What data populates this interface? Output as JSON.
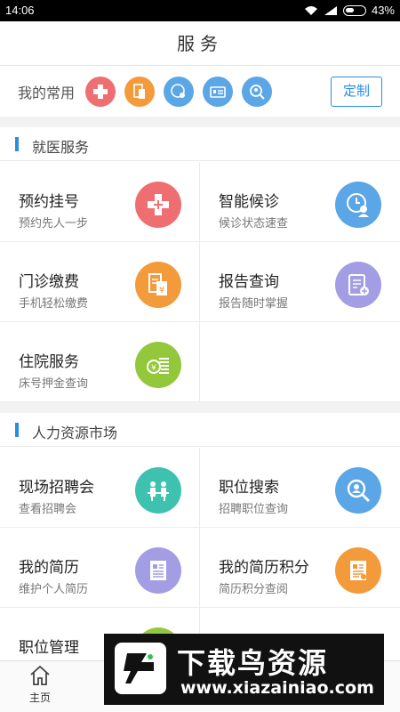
{
  "status": {
    "time": "14:06",
    "battery": "43%"
  },
  "header": {
    "title": "服务"
  },
  "frequent": {
    "label": "我的常用",
    "custom_label": "定制",
    "icons": [
      {
        "icon": "cross-icon",
        "color": "#ef6e72"
      },
      {
        "icon": "receipt-icon",
        "color": "#f39a3b"
      },
      {
        "icon": "clock-user-icon",
        "color": "#5aa6e6"
      },
      {
        "icon": "card-icon",
        "color": "#5aa6e6"
      },
      {
        "icon": "search-person-icon",
        "color": "#5aa6e6"
      }
    ]
  },
  "sections": [
    {
      "title": "就医服务",
      "items": [
        {
          "title": "预约挂号",
          "subtitle": "预约先人一步",
          "icon": "cross-icon",
          "color": "#ef6e72"
        },
        {
          "title": "智能候诊",
          "subtitle": "候诊状态速查",
          "icon": "clock-user-icon",
          "color": "#5aa6e6"
        },
        {
          "title": "门诊缴费",
          "subtitle": "手机轻松缴费",
          "icon": "receipt-icon",
          "color": "#f39a3b"
        },
        {
          "title": "报告查询",
          "subtitle": "报告随时掌握",
          "icon": "report-icon",
          "color": "#a39ee3"
        },
        {
          "title": "住院服务",
          "subtitle": "床号押金查询",
          "icon": "money-icon",
          "color": "#93c83c"
        }
      ]
    },
    {
      "title": "人力资源市场",
      "items": [
        {
          "title": "现场招聘会",
          "subtitle": "查看招聘会",
          "icon": "meeting-icon",
          "color": "#3fc1b0"
        },
        {
          "title": "职位搜索",
          "subtitle": "招聘职位查询",
          "icon": "search-person-icon",
          "color": "#5aa6e6"
        },
        {
          "title": "我的简历",
          "subtitle": "维护个人简历",
          "icon": "resume-icon",
          "color": "#a39ee3"
        },
        {
          "title": "我的简历积分",
          "subtitle": "简历积分查阅",
          "icon": "resume-points-icon",
          "color": "#f39a3b"
        },
        {
          "title": "职位管理",
          "subtitle": "",
          "icon": "manage-icon",
          "color": "#93c83c"
        }
      ]
    }
  ],
  "nav": {
    "home_label": "主页"
  },
  "watermark": {
    "title": "下载鸟资源",
    "url": "www.xiazainiao.com"
  }
}
